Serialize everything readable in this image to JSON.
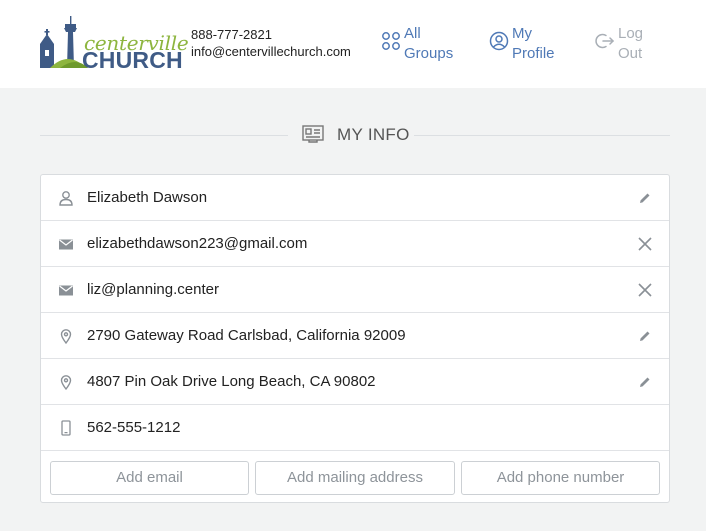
{
  "logo": {
    "word1": "centerville",
    "word2": "CHURCH",
    "icon": "space-needle-church-logo"
  },
  "contact": {
    "phone": "888-777-2821",
    "email": "info@centervillechurch.com"
  },
  "nav": [
    {
      "line1": "All",
      "line2": "Groups",
      "icon": "groups-icon"
    },
    {
      "line1": "My",
      "line2": "Profile",
      "icon": "profile-icon"
    },
    {
      "line1": "Log",
      "line2": "Out",
      "icon": "logout-icon"
    }
  ],
  "section": {
    "title": "MY INFO",
    "icon": "id-card-icon"
  },
  "rows": [
    {
      "text": "Elizabeth Dawson",
      "icon": "person-icon",
      "action": "edit-icon"
    },
    {
      "text": "elizabethdawson223@gmail.com",
      "icon": "envelope-icon",
      "action": "close-icon"
    },
    {
      "text": "liz@planning.center",
      "icon": "envelope-icon",
      "action": "close-icon"
    },
    {
      "text": "2790 Gateway Road Carlsbad, California 92009",
      "icon": "map-pin-icon",
      "action": "edit-icon"
    },
    {
      "text": "4807 Pin Oak Drive Long Beach, CA 90802",
      "icon": "map-pin-icon",
      "action": "edit-icon"
    },
    {
      "text": "562-555-1212",
      "icon": "mobile-phone-icon",
      "action": ""
    }
  ],
  "buttons": {
    "add_email": "Add email",
    "add_mailing": "Add mailing address",
    "add_phone": "Add phone number"
  },
  "colors": {
    "link_blue": "#4f79b6",
    "logo_green": "#8db53f",
    "logo_navy": "#3f5b86",
    "page_bg": "#f2f3f3"
  }
}
